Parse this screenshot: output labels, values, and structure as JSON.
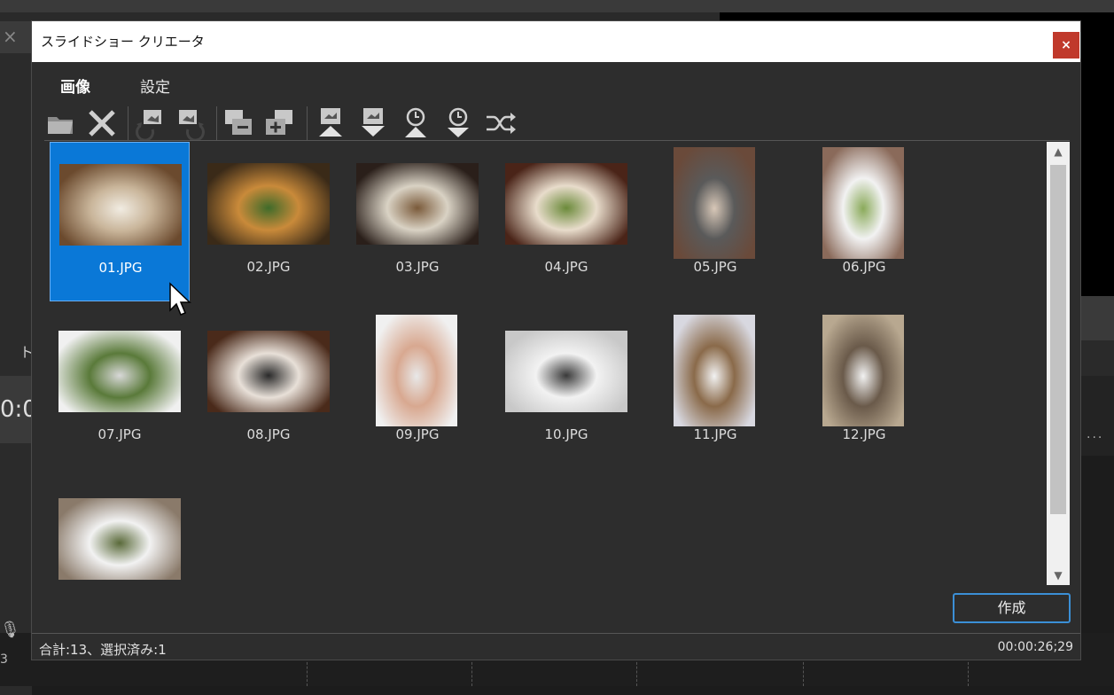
{
  "dialog": {
    "title": "スライドショー クリエータ",
    "close_label": "×"
  },
  "tabs": [
    {
      "label": "画像",
      "active": true
    },
    {
      "label": "設定",
      "active": false
    }
  ],
  "toolbar": {
    "buttons": [
      {
        "name": "open-folder-icon"
      },
      {
        "name": "delete-icon"
      },
      {
        "name": "rotate-left-icon"
      },
      {
        "name": "rotate-right-icon"
      },
      {
        "name": "remove-image-icon"
      },
      {
        "name": "add-image-icon"
      },
      {
        "name": "move-to-top-icon"
      },
      {
        "name": "move-to-bottom-icon"
      },
      {
        "name": "sort-time-ascending-icon"
      },
      {
        "name": "sort-time-descending-icon"
      },
      {
        "name": "shuffle-icon"
      }
    ]
  },
  "images": [
    {
      "label": "01.JPG",
      "selected": true,
      "orientation": "landscape",
      "colors": [
        "#6b4a2e",
        "#c9b59a",
        "#f1ece2"
      ]
    },
    {
      "label": "02.JPG",
      "selected": false,
      "orientation": "landscape",
      "colors": [
        "#3a2a18",
        "#c98a3a",
        "#3f6b2a"
      ]
    },
    {
      "label": "03.JPG",
      "selected": false,
      "orientation": "landscape",
      "colors": [
        "#2a1f1a",
        "#d9d2c4",
        "#7a5a3a"
      ]
    },
    {
      "label": "04.JPG",
      "selected": false,
      "orientation": "landscape",
      "colors": [
        "#4a2418",
        "#e8dccb",
        "#6b8a3a"
      ]
    },
    {
      "label": "05.JPG",
      "selected": false,
      "orientation": "portrait",
      "colors": [
        "#6a4a3a",
        "#5a5a5a",
        "#d8c8b8"
      ]
    },
    {
      "label": "06.JPG",
      "selected": false,
      "orientation": "portrait",
      "colors": [
        "#8a6a5a",
        "#f2f2f2",
        "#8aaa5a"
      ]
    },
    {
      "label": "07.JPG",
      "selected": false,
      "orientation": "landscape",
      "colors": [
        "#f0f0f0",
        "#5a7a3a",
        "#d8d8d8"
      ]
    },
    {
      "label": "08.JPG",
      "selected": false,
      "orientation": "landscape",
      "colors": [
        "#4a2a1a",
        "#e8e0d8",
        "#2a2a2a"
      ]
    },
    {
      "label": "09.JPG",
      "selected": false,
      "orientation": "portrait",
      "colors": [
        "#f0f0f0",
        "#d8a890",
        "#e8e8e8"
      ]
    },
    {
      "label": "10.JPG",
      "selected": false,
      "orientation": "landscape",
      "colors": [
        "#c8c8c8",
        "#f2f2f2",
        "#3a3a3a"
      ]
    },
    {
      "label": "11.JPG",
      "selected": false,
      "orientation": "portrait",
      "colors": [
        "#d8d8e0",
        "#8a6a4a",
        "#f2f2f2"
      ]
    },
    {
      "label": "12.JPG",
      "selected": false,
      "orientation": "portrait",
      "colors": [
        "#b8a890",
        "#6a5a4a",
        "#f2f2f2"
      ]
    },
    {
      "label": "",
      "selected": false,
      "orientation": "landscape",
      "colors": [
        "#8a7a6a",
        "#f2f2f2",
        "#5a6a3a"
      ]
    }
  ],
  "create_button": "作成",
  "status": {
    "summary": "合計:13、選択済み:1",
    "duration": "00:00:26;29"
  },
  "colors": {
    "selection": "#0a78d7",
    "create_border": "#3b8fd6",
    "close_button": "#c0392b"
  }
}
